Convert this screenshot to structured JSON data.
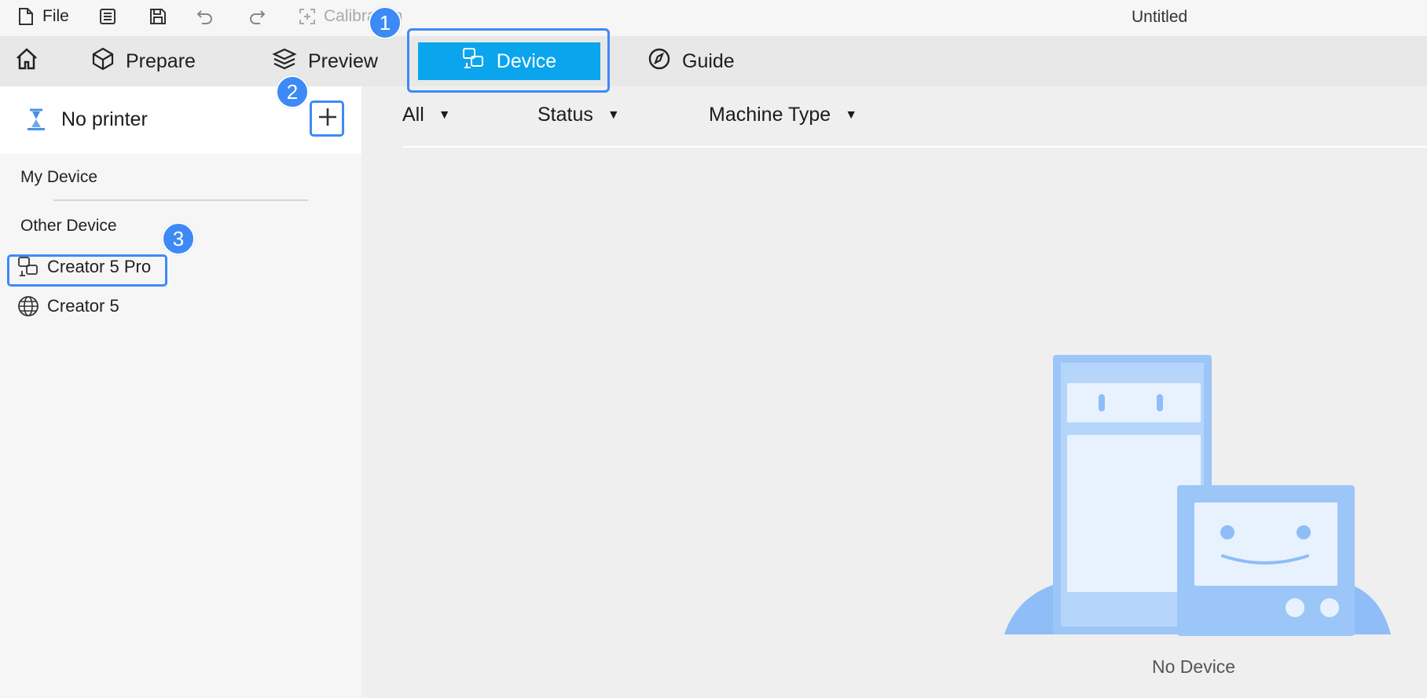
{
  "menubar": {
    "file_label": "File",
    "calibration_label": "Calibration",
    "document_title": "Untitled"
  },
  "nav": {
    "tabs": [
      {
        "label": "Prepare"
      },
      {
        "label": "Preview"
      },
      {
        "label": "Device"
      },
      {
        "label": "Guide"
      }
    ],
    "active_tab": "Device"
  },
  "sidebar": {
    "printer_name": "No printer",
    "my_device_label": "My Device",
    "other_device_label": "Other Device",
    "devices": [
      {
        "name": "Creator 5 Pro",
        "icon": "device-link-icon"
      },
      {
        "name": "Creator 5",
        "icon": "globe-icon"
      }
    ]
  },
  "filters": {
    "all": "All",
    "status": "Status",
    "machine_type": "Machine Type"
  },
  "main": {
    "empty_message": "No Device"
  },
  "callouts": [
    "1",
    "2",
    "3"
  ],
  "colors": {
    "accent": "#0aa5ec",
    "highlight": "#3d8af7",
    "illustration": "#8ebdf7"
  }
}
